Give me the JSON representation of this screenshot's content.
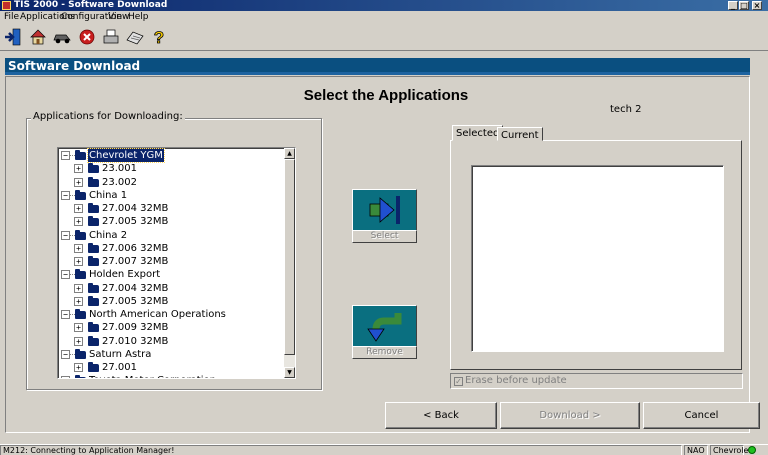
{
  "window": {
    "title": "TIS 2000 - Software Download",
    "minimize": "_",
    "maximize": "□",
    "close": "×"
  },
  "menu": [
    "File",
    "Applications",
    "Configuration",
    "View",
    "Help"
  ],
  "toolbar": {
    "icons": [
      "exit-icon",
      "home-icon",
      "vehicle-icon",
      "stop-icon",
      "print-icon",
      "keyboard-icon",
      "help-icon"
    ]
  },
  "header": {
    "title": "Software Download"
  },
  "page": {
    "title": "Select the Applications",
    "tech_label": "tech 2"
  },
  "apps_group": {
    "label": "Applications for Downloading:"
  },
  "tree": [
    {
      "label": "Chevrolet YGM",
      "level": 0,
      "selected": true
    },
    {
      "label": "23.001",
      "level": 1
    },
    {
      "label": "23.002",
      "level": 1
    },
    {
      "label": "China 1",
      "level": 0
    },
    {
      "label": "27.004 32MB",
      "level": 1
    },
    {
      "label": "27.005 32MB",
      "level": 1
    },
    {
      "label": "China 2",
      "level": 0
    },
    {
      "label": "27.006 32MB",
      "level": 1
    },
    {
      "label": "27.007 32MB",
      "level": 1
    },
    {
      "label": "Holden Export",
      "level": 0
    },
    {
      "label": "27.004 32MB",
      "level": 1
    },
    {
      "label": "27.005 32MB",
      "level": 1
    },
    {
      "label": "North American Operations",
      "level": 0
    },
    {
      "label": "27.009 32MB",
      "level": 1
    },
    {
      "label": "27.010 32MB",
      "level": 1
    },
    {
      "label": "Saturn Astra",
      "level": 0
    },
    {
      "label": "27.001",
      "level": 1
    },
    {
      "label": "Toyota Motor Corporation",
      "level": 0
    }
  ],
  "actions": {
    "select": "Select",
    "remove": "Remove"
  },
  "tabs": [
    {
      "label": "Selected"
    },
    {
      "label": "Current"
    }
  ],
  "erase": {
    "label": "Erase before update"
  },
  "nav": {
    "back": "< Back",
    "download": "Download >",
    "cancel": "Cancel"
  },
  "status": {
    "message": "M212: Connecting to Application Manager!",
    "region": "NAO",
    "make": "Chevrolet"
  },
  "colors": {
    "header": "#0a4f80",
    "button_face": "#0a6f80",
    "selection": "#0a246a"
  }
}
